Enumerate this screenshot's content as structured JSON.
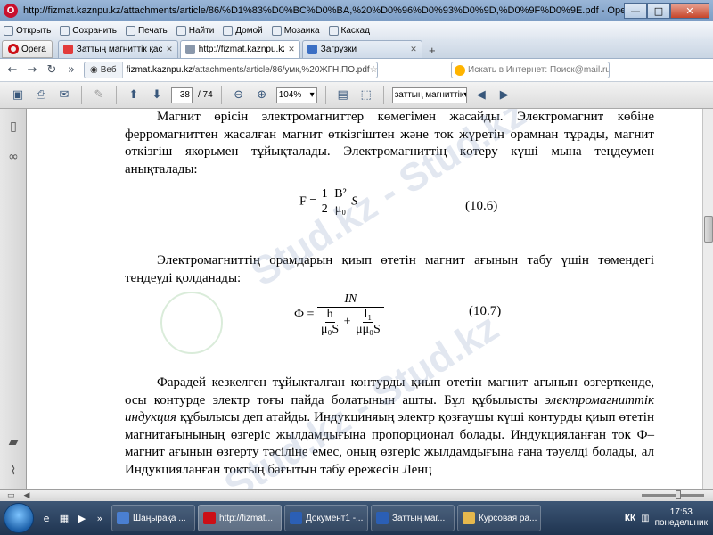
{
  "window": {
    "title": "http://fizmat.kaznpu.kz/attachments/article/86/%D1%83%D0%BC%D0%BA,%20%D0%96%D0%93%D0%9D,%D0%9F%D0%9E.pdf - Opera",
    "icon_label": "O",
    "minimize": "—",
    "maximize": "□",
    "close": "✕"
  },
  "commands": [
    {
      "label": "Открыть",
      "icon": "folder-icon"
    },
    {
      "label": "Сохранить",
      "icon": "save-icon"
    },
    {
      "label": "Печать",
      "icon": "print-icon"
    },
    {
      "label": "Найти",
      "icon": "find-icon"
    },
    {
      "label": "Домой",
      "icon": "home-icon"
    },
    {
      "label": "Мозаика",
      "icon": "tile-icon"
    },
    {
      "label": "Каскад",
      "icon": "cascade-icon"
    }
  ],
  "tabs": {
    "opera_menu": "Opera",
    "items": [
      {
        "label": "Заттың магниттік қасиет",
        "favicon_color": "#e23b3b",
        "active": false
      },
      {
        "label": "http://fizmat.kaznpu.kz",
        "favicon_color": "#8a98ab",
        "active": true
      },
      {
        "label": "Загрузки",
        "favicon_color": "#3b6fc4",
        "active": false
      }
    ],
    "new_tab": "+"
  },
  "address": {
    "web_label": "Веб",
    "host": "fizmat.kaznpu.kz",
    "path": "/attachments/article/86/умк,%20ЖГН,ПО.pdf",
    "search_placeholder": "Искать в Интернет: Поиск@mail.ru"
  },
  "pdf_toolbar": {
    "current_page": "38",
    "page_total": "/ 74",
    "zoom": "104%",
    "find_text": "заттың магниттік"
  },
  "document": {
    "para1": "Магнит өрісін электромагниттер көмегімен жасайды. Электромагнит көбіне ферромагниттен жасалған магнит өткізгіштен және ток жүретін орамнан тұрады, магнит өткізгіш якорьмен тұйықталады. Электромагниттің көтеру күші мына теңдеумен анықталады:",
    "eq1": {
      "lhs": "F =",
      "frac1_num": "1",
      "frac1_den": "2",
      "frac2_num": "B²",
      "frac2_den": "μ₀",
      "tail": "S",
      "number": "(10.6)"
    },
    "para2": "Электромагниттің орамдарын қиып өтетін магнит ағынын табу үшін төмендегі теңдеуді қолданады:",
    "eq2": {
      "lhs": "Ф =",
      "num": "IN",
      "t1_num": "h",
      "t1_den": "μ₀S",
      "plus": "+",
      "t2_num": "l₁",
      "t2_den": "μμ₀S",
      "number": "(10.7)"
    },
    "para3_start": "Фарадей кезкелген тұйықталған контурды қиып өтетін магнит ағынын өзгерткенде, осы контурде электр тоғы пайда болатынын ашты. Бұл құбылысты ",
    "para3_italic": "электромагниттік индукция",
    "para3_end": " құбылысы деп атайды. Индукциняың электр қозғаушы күші контурды қиып өтетін магнитағынының өзгеріс жылдамдығына пропорционал болады. Индукцияланған ток Ф–магнит ағынын өзгерту тәсіліне емес, оның өзгеріс жылдамдығына ғана тәуелді болады, ал Индукцияланған токтың бағытын табу ережесін Ленц"
  },
  "watermark": "Stud.kz - Stud.kz",
  "taskbar": {
    "tasks": [
      {
        "label": "Шаңырақа ...",
        "color": "#4a7fd1",
        "active": false
      },
      {
        "label": "http://fizmat...",
        "color": "#cc0f16",
        "active": true
      },
      {
        "label": "Документ1 -...",
        "color": "#2b5fb5",
        "active": false
      },
      {
        "label": "Заттың маг...",
        "color": "#2b5fb5",
        "active": false
      },
      {
        "label": "Курсовая ра...",
        "color": "#e6b84d",
        "active": false
      }
    ],
    "language": "КК",
    "time": "17:53",
    "day": "понедельник"
  }
}
